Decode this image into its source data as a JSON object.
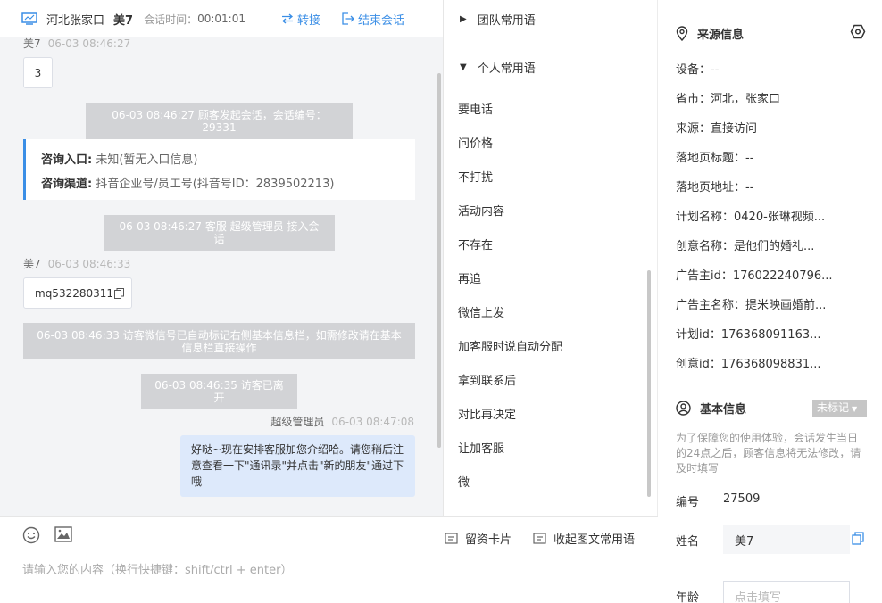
{
  "header": {
    "location": "河北张家口",
    "visitor_name": "美7",
    "session_time_label": "会话时间：",
    "session_time_value": "00:01:01",
    "transfer_label": "转接",
    "end_label": "结束会话"
  },
  "messages": {
    "m1_sender": "美7",
    "m1_time": "06-03 08:46:27",
    "m1_text": "3",
    "sys1": "06-03 08:46:27 顾客发起会话，会话编号：29331",
    "entry_label": "咨询入口:",
    "entry_value": "未知(暂无入口信息)",
    "channel_label": "咨询渠道:",
    "channel_value": "抖音企业号/员工号(抖音号ID：2839502213)",
    "sys2": "06-03 08:46:27 客服 超级管理员 接入会话",
    "m2_sender": "美7",
    "m2_time": "06-03 08:46:33",
    "m2_text": "mq532280311",
    "sys3": "06-03 08:46:33 访客微信号已自动标记右侧基本信息栏，如需修改请在基本信息栏直接操作",
    "sys4": "06-03 08:46:35 访客已离开",
    "m3_sender": "超级管理员",
    "m3_time": "06-03 08:47:08",
    "m3_text": "好哒~现在安排客服加您介绍哈。请您稍后注意查看一下\"通讯录\"并点击\"新的朋友\"通过下哦"
  },
  "input": {
    "card_label": "留资卡片",
    "collapse_label": "收起图文常用语",
    "placeholder": "请输入您的内容（换行快捷键：shift/ctrl + enter）"
  },
  "phrases": {
    "team_group": "团队常用语",
    "personal_group": "个人常用语",
    "items": [
      "要电话",
      "问价格",
      "不打扰",
      "活动内容",
      "不存在",
      "再追",
      "微信上发",
      "加客服时说自动分配",
      "拿到联系后",
      "对比再决定",
      "让加客服",
      "微"
    ]
  },
  "info": {
    "source_title": "来源信息",
    "rows": [
      "设备：--",
      "省市：河北，张家口",
      "来源：直接访问",
      "落地页标题：--",
      "落地页地址：--",
      "计划名称：0420-张琳视频...",
      "创意名称：是他们的婚礼...",
      "广告主id：176022240796...",
      "广告主名称：提米映画婚前...",
      "计划id：176368091163...",
      "创意id：176368098831..."
    ],
    "basic_title": "基本信息",
    "tag_label": "未标记",
    "note": "为了保障您的使用体验，会话发生当日的24点之后，顾客信息将无法修改，请及时填写",
    "id_label": "编号",
    "id_value": "27509",
    "name_label": "姓名",
    "name_value": "美7",
    "age_label": "年龄",
    "age_placeholder": "点击填写"
  },
  "colors": {
    "accent": "#3a8ee6",
    "system_message_bg": "#d2d3d6",
    "agent_bubble_bg": "#dde9fb"
  }
}
